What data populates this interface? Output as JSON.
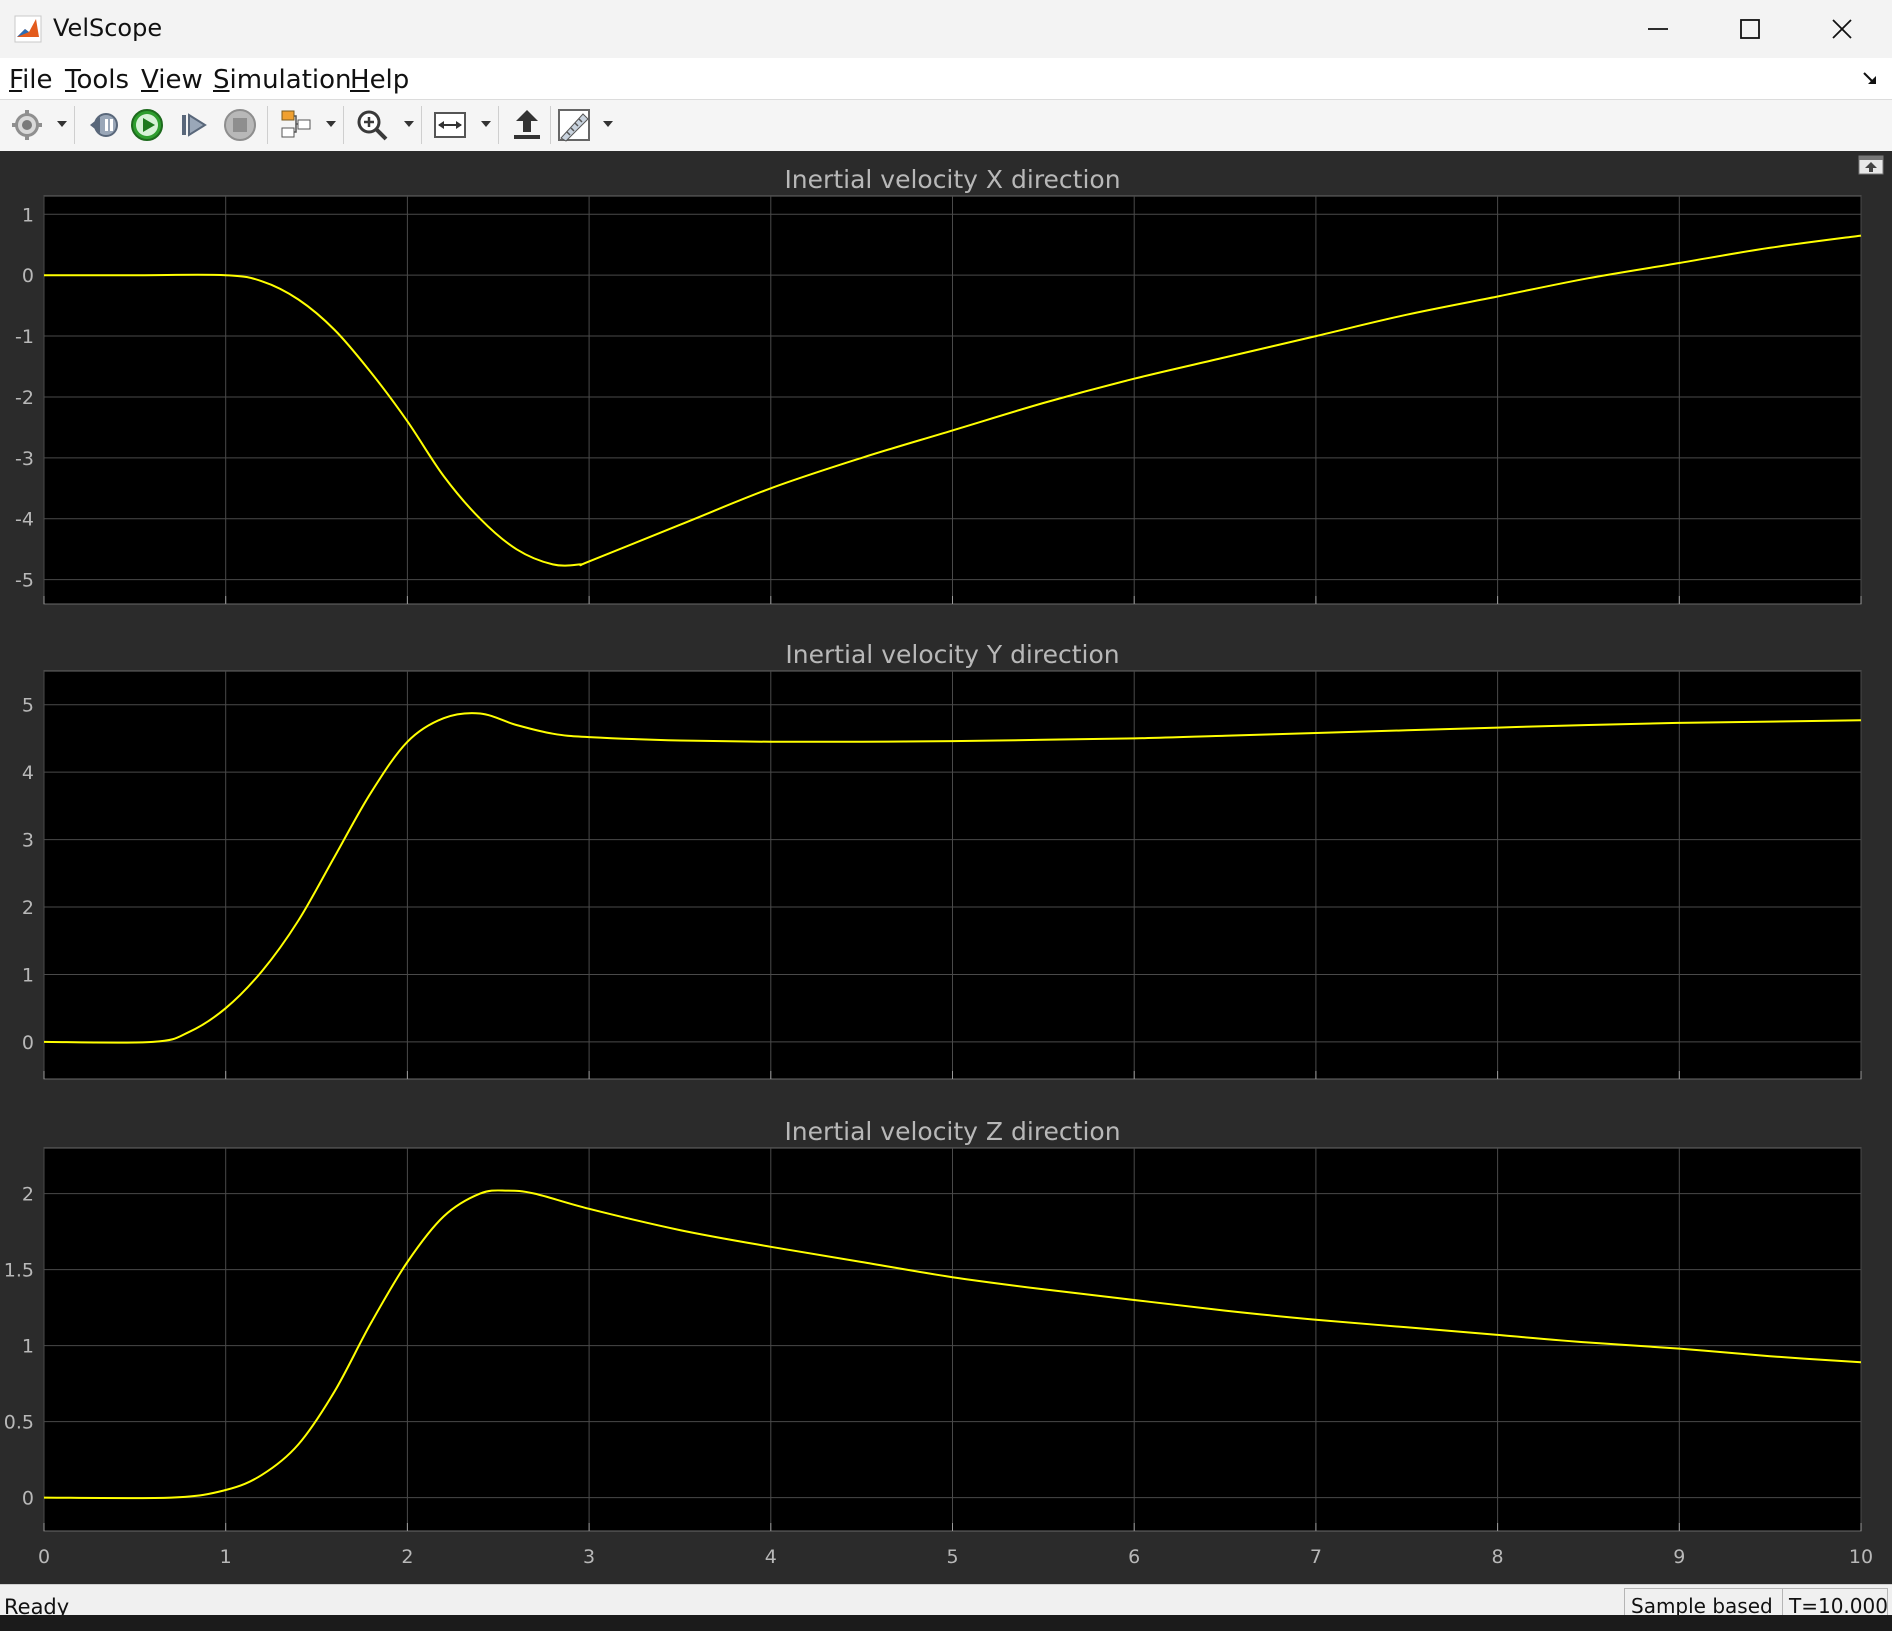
{
  "window": {
    "title": "VelScope",
    "controls": [
      "minimize",
      "maximize",
      "close"
    ]
  },
  "menu": [
    {
      "label": "File",
      "mnemonic": "F",
      "rest": "ile"
    },
    {
      "label": "Tools",
      "mnemonic": "T",
      "rest": "ools"
    },
    {
      "label": "View",
      "mnemonic": "V",
      "rest": "iew"
    },
    {
      "label": "Simulation",
      "mnemonic": "S",
      "rest": "imulation"
    },
    {
      "label": "Help",
      "mnemonic": "H",
      "rest": "elp"
    }
  ],
  "toolbar": {
    "icons": [
      "gear-icon",
      "step-back-icon",
      "run-icon",
      "step-forward-icon",
      "stop-icon",
      "signal-highlight-icon",
      "zoom-icon",
      "autoscale-icon",
      "undock-arrow-icon",
      "measure-icon"
    ],
    "run_color": "#2e9e2e"
  },
  "status": {
    "text": "Ready",
    "mode": "Sample based",
    "time": "T=10.000"
  },
  "colors": {
    "plot_background": "#000000",
    "figure_background": "#2b2b2b",
    "grid": "#4a4a4a",
    "trace": "#ffff00",
    "axis_text": "#b8b8b8"
  },
  "chart_data": [
    {
      "type": "line",
      "title": "Inertial velocity X direction",
      "xlim": [
        0,
        10
      ],
      "ylim": [
        -5.4,
        1.3
      ],
      "xticks": [
        0,
        1,
        2,
        3,
        4,
        5,
        6,
        7,
        8,
        9,
        10
      ],
      "yticks": [
        1,
        0,
        -1,
        -2,
        -3,
        -4,
        -5
      ],
      "grid": true,
      "x": [
        0,
        0.5,
        1.0,
        1.2,
        1.4,
        1.6,
        1.8,
        2.0,
        2.2,
        2.4,
        2.6,
        2.8,
        2.95,
        3.0,
        3.5,
        4.0,
        4.5,
        5.0,
        5.5,
        6.0,
        6.5,
        7.0,
        7.5,
        8.0,
        8.5,
        9.0,
        9.5,
        10.0
      ],
      "y": [
        0,
        0,
        0,
        -0.1,
        -0.4,
        -0.9,
        -1.6,
        -2.4,
        -3.3,
        -4.0,
        -4.5,
        -4.75,
        -4.75,
        -4.7,
        -4.1,
        -3.5,
        -3.0,
        -2.55,
        -2.1,
        -1.7,
        -1.35,
        -1.0,
        -0.65,
        -0.35,
        -0.05,
        0.2,
        0.45,
        0.65
      ]
    },
    {
      "type": "line",
      "title": "Inertial velocity Y direction",
      "xlim": [
        0,
        10
      ],
      "ylim": [
        -0.55,
        5.5
      ],
      "xticks": [
        0,
        1,
        2,
        3,
        4,
        5,
        6,
        7,
        8,
        9,
        10
      ],
      "yticks": [
        5,
        4,
        3,
        2,
        1,
        0
      ],
      "grid": true,
      "x": [
        0,
        0.6,
        0.8,
        1.0,
        1.2,
        1.4,
        1.6,
        1.8,
        2.0,
        2.2,
        2.4,
        2.6,
        2.8,
        3.0,
        3.5,
        4.0,
        4.5,
        5.0,
        5.5,
        6.0,
        6.5,
        7.0,
        7.5,
        8.0,
        8.5,
        9.0,
        9.5,
        10.0
      ],
      "y": [
        0,
        0,
        0.15,
        0.5,
        1.05,
        1.8,
        2.75,
        3.7,
        4.45,
        4.8,
        4.87,
        4.7,
        4.57,
        4.52,
        4.47,
        4.45,
        4.45,
        4.46,
        4.48,
        4.5,
        4.54,
        4.58,
        4.62,
        4.66,
        4.7,
        4.73,
        4.75,
        4.77
      ]
    },
    {
      "type": "line",
      "title": "Inertial velocity Z direction",
      "xlim": [
        0,
        10
      ],
      "ylim": [
        -0.22,
        2.3
      ],
      "xticks": [
        0,
        1,
        2,
        3,
        4,
        5,
        6,
        7,
        8,
        9,
        10
      ],
      "yticks": [
        2,
        1.5,
        1,
        0.5,
        0
      ],
      "xticklabels_shown": true,
      "grid": true,
      "x": [
        0,
        0.7,
        1.0,
        1.2,
        1.4,
        1.6,
        1.8,
        2.0,
        2.2,
        2.4,
        2.55,
        2.7,
        3.0,
        3.5,
        4.0,
        4.5,
        5.0,
        5.5,
        6.0,
        6.5,
        7.0,
        7.5,
        8.0,
        8.5,
        9.0,
        9.5,
        10.0
      ],
      "y": [
        0,
        0,
        0.05,
        0.15,
        0.35,
        0.7,
        1.15,
        1.55,
        1.85,
        2.0,
        2.02,
        2.0,
        1.9,
        1.76,
        1.65,
        1.55,
        1.45,
        1.37,
        1.3,
        1.23,
        1.17,
        1.12,
        1.07,
        1.02,
        0.98,
        0.93,
        0.89
      ]
    }
  ]
}
